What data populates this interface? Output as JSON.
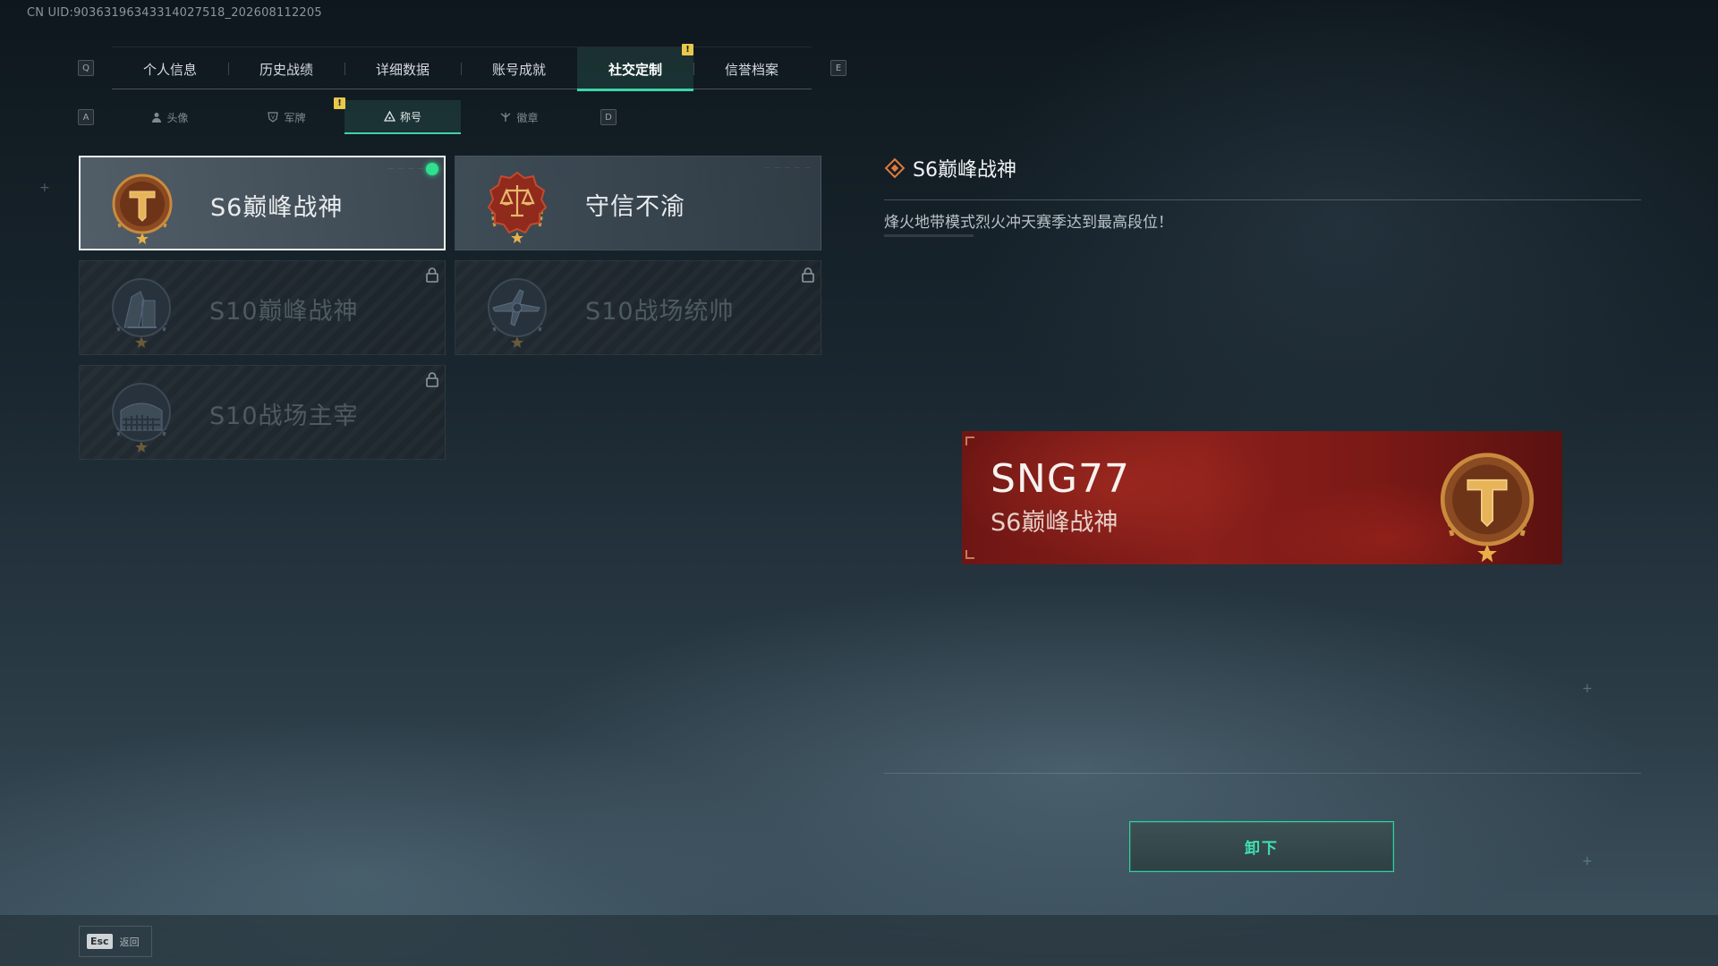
{
  "uid_text": "CN UID:9036319634331402751​8_202608112205",
  "header": {
    "key_prev": "Q",
    "key_next": "E",
    "tabs": [
      {
        "label": "个人信息"
      },
      {
        "label": "历史战绩"
      },
      {
        "label": "详细数据"
      },
      {
        "label": "账号成就"
      },
      {
        "label": "社交定制",
        "active": true,
        "badge": "!"
      },
      {
        "label": "信誉档案"
      }
    ]
  },
  "subnav": {
    "key_prev": "A",
    "key_next": "D",
    "tabs": [
      {
        "label": "头像",
        "icon": "person-icon"
      },
      {
        "label": "军牌",
        "icon": "dogtag-icon",
        "badge": "!"
      },
      {
        "label": "称号",
        "icon": "title-icon",
        "active": true
      },
      {
        "label": "徽章",
        "icon": "insignia-icon"
      }
    ]
  },
  "titles": [
    {
      "label": "S6巅峰战神",
      "selected": true,
      "equipped": true,
      "locked": false,
      "emblem": "s6-peak-emblem-icon"
    },
    {
      "label": "守信不渝",
      "selected": false,
      "equipped": false,
      "locked": false,
      "emblem": "scales-emblem-icon"
    },
    {
      "label": "S10巅峰战神",
      "selected": false,
      "equipped": false,
      "locked": true,
      "emblem": "s10-peak-emblem-icon"
    },
    {
      "label": "S10战场统帅",
      "selected": false,
      "equipped": false,
      "locked": true,
      "emblem": "s10-commander-emblem-icon"
    },
    {
      "label": "S10战场主宰",
      "selected": false,
      "equipped": false,
      "locked": true,
      "emblem": "s10-dominator-emblem-icon"
    }
  ],
  "detail": {
    "title": "S6巅峰战神",
    "description": "烽火地带模式烈火冲天赛季达到最高段位！",
    "preview": {
      "player_name": "SNG77",
      "title": "S6巅峰战神"
    },
    "action_label": "卸下"
  },
  "footer": {
    "esc_key": "Esc",
    "back_label": "返回"
  },
  "colors": {
    "accent": "#3fd3a6",
    "equipped_dot": "#2fe08f",
    "warning": "#e8c94b",
    "banner_red": "#8a1f1b"
  }
}
